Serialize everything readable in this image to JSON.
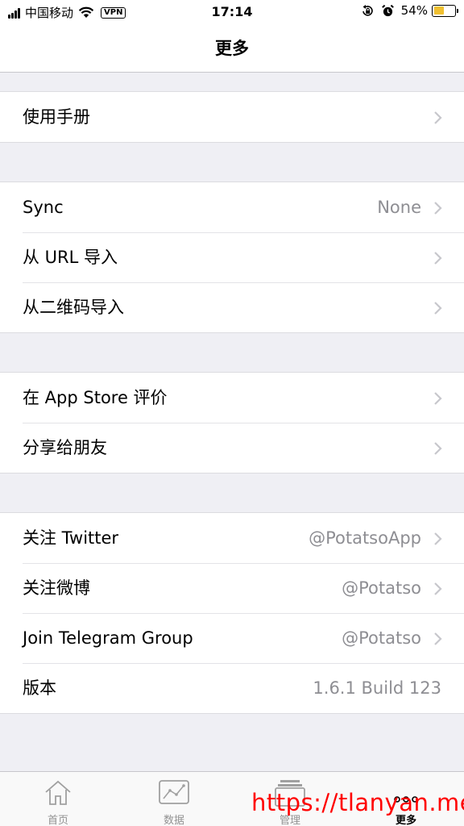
{
  "status_bar": {
    "carrier": "中国移动",
    "vpn": "VPN",
    "time": "17:14",
    "battery_percent": "54%",
    "battery_level": 0.54,
    "battery_color": "#f0c030",
    "icons": [
      "signal-icon",
      "wifi-icon",
      "lock-rotation-icon",
      "alarm-icon",
      "battery-icon"
    ]
  },
  "nav": {
    "title": "更多"
  },
  "groups": [
    {
      "items": [
        {
          "label": "使用手册",
          "detail": ""
        }
      ]
    },
    {
      "items": [
        {
          "label": "Sync",
          "detail": "None"
        },
        {
          "label": "从 URL 导入",
          "detail": ""
        },
        {
          "label": "从二维码导入",
          "detail": ""
        }
      ]
    },
    {
      "items": [
        {
          "label": "在 App Store 评价",
          "detail": ""
        },
        {
          "label": "分享给朋友",
          "detail": ""
        }
      ]
    },
    {
      "items": [
        {
          "label": "关注 Twitter",
          "detail": "@PotatsoApp"
        },
        {
          "label": "关注微博",
          "detail": "@Potatso"
        },
        {
          "label": "Join Telegram Group",
          "detail": "@Potatso"
        },
        {
          "label": "版本",
          "detail": "1.6.1 Build 123"
        }
      ]
    }
  ],
  "tabs": [
    {
      "label": "首页",
      "icon": "home-icon",
      "active": false
    },
    {
      "label": "数据",
      "icon": "chart-icon",
      "active": false
    },
    {
      "label": "管理",
      "icon": "stack-icon",
      "active": false
    },
    {
      "label": "更多",
      "icon": "more-dots-icon",
      "active": true
    }
  ],
  "watermark": "https://tlanyan.me"
}
